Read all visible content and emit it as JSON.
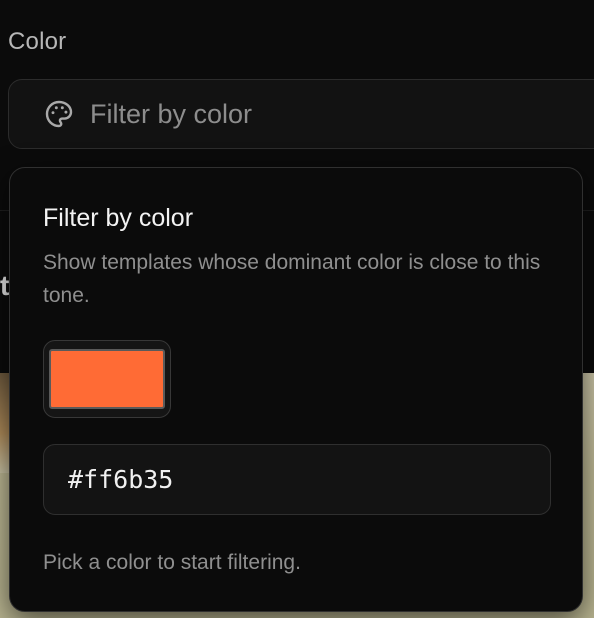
{
  "section": {
    "label": "Color"
  },
  "filter_trigger": {
    "icon": "palette-icon",
    "placeholder": "Filter by color"
  },
  "background": {
    "partial_glyph": "t"
  },
  "popover": {
    "title": "Filter by color",
    "description": "Show templates whose dominant color is close to this tone.",
    "swatch_color": "#ff6b35",
    "hex_value": "#ff6b35",
    "hint": "Pick a color to start filtering."
  }
}
